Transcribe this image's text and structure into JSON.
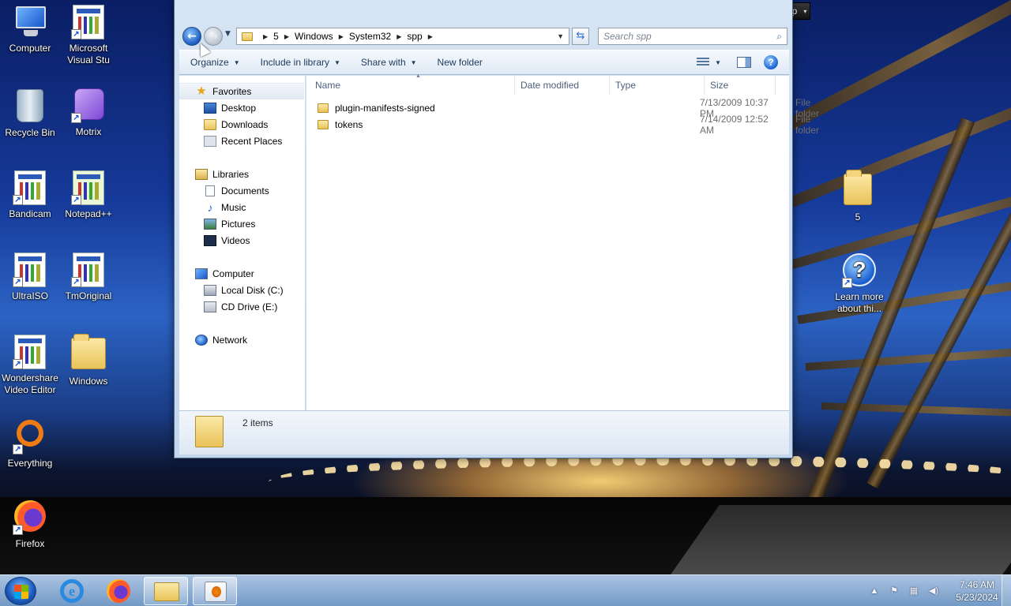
{
  "desktop": {
    "icons_left": [
      {
        "label": "Computer",
        "icon": "computer-icon"
      },
      {
        "label": "Microsoft Visual Stu",
        "icon": "app-shortcut-icon"
      },
      {
        "label": "Recycle Bin",
        "icon": "recycle-bin-icon"
      },
      {
        "label": "Motrix",
        "icon": "motrix-icon"
      },
      {
        "label": "Bandicam",
        "icon": "app-shortcut-icon"
      },
      {
        "label": "Notepad++",
        "icon": "notepad-plus-plus-icon"
      },
      {
        "label": "UltraISO",
        "icon": "app-shortcut-icon"
      },
      {
        "label": "TmOriginal",
        "icon": "app-shortcut-icon"
      },
      {
        "label": "Wondershare Video Editor",
        "icon": "app-shortcut-icon"
      },
      {
        "label": "Windows",
        "icon": "folder-icon"
      },
      {
        "label": "Everything",
        "icon": "everything-icon"
      },
      {
        "label": "Firefox",
        "icon": "firefox-icon"
      }
    ],
    "icons_right": [
      {
        "label": "5",
        "icon": "folder-icon"
      },
      {
        "label": "Learn more about thi...",
        "icon": "help-icon"
      }
    ]
  },
  "window": {
    "breadcrumb": [
      "5",
      "Windows",
      "System32",
      "spp"
    ],
    "search_placeholder": "Search spp",
    "commands": {
      "organize": "Organize",
      "include_in_library": "Include in library",
      "share_with": "Share with",
      "new_folder": "New folder"
    },
    "nav": {
      "favorites": {
        "label": "Favorites",
        "items": [
          "Desktop",
          "Downloads",
          "Recent Places"
        ]
      },
      "libraries": {
        "label": "Libraries",
        "items": [
          "Documents",
          "Music",
          "Pictures",
          "Videos"
        ]
      },
      "computer": {
        "label": "Computer",
        "items": [
          "Local Disk (C:)",
          "CD Drive (E:)"
        ]
      },
      "network": {
        "label": "Network"
      }
    },
    "columns": {
      "name": "Name",
      "date_modified": "Date modified",
      "type": "Type",
      "size": "Size"
    },
    "files": [
      {
        "name": "plugin-manifests-signed",
        "date": "7/13/2009 10:37 PM",
        "type": "File folder",
        "size": ""
      },
      {
        "name": "tokens",
        "date": "7/14/2009 12:52 AM",
        "type": "File folder",
        "size": ""
      }
    ],
    "status": {
      "count": "2 items"
    }
  },
  "langbar": {
    "lang": "US",
    "help": "Help"
  },
  "taskbar": {
    "clock_time": "7:46 AM",
    "clock_date": "5/23/2024"
  }
}
